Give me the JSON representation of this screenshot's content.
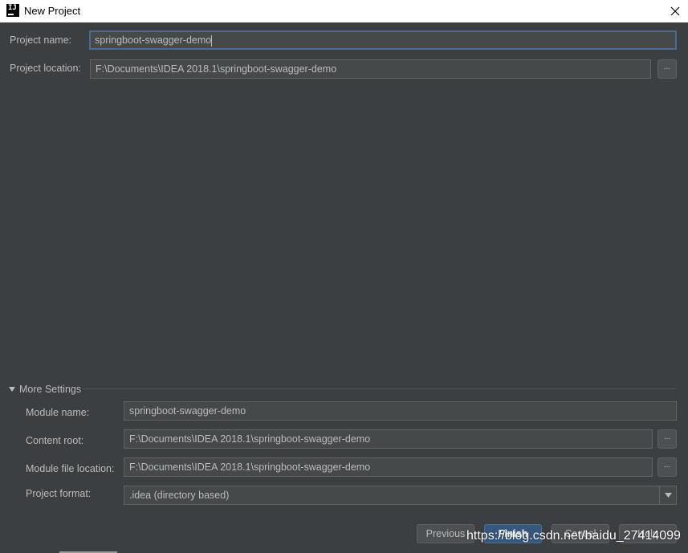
{
  "window": {
    "title": "New Project",
    "logo_text": "IJ"
  },
  "project": {
    "name_label": "Project name:",
    "name_value": "springboot-swagger-demo",
    "location_label": "Project location:",
    "location_value": "F:\\Documents\\IDEA 2018.1\\springboot-swagger-demo"
  },
  "more_settings": {
    "header": "More Settings",
    "module_name_label": "Module name:",
    "module_name_value": "springboot-swagger-demo",
    "content_root_label": "Content root:",
    "content_root_value": "F:\\Documents\\IDEA 2018.1\\springboot-swagger-demo",
    "module_file_label": "Module file location:",
    "module_file_value": "F:\\Documents\\IDEA 2018.1\\springboot-swagger-demo",
    "format_label": "Project format:",
    "format_value": ".idea (directory based)"
  },
  "browse_label": "...",
  "buttons": {
    "previous": "Previous",
    "finish": "Finish",
    "cancel": "Cancel",
    "help": "Help"
  },
  "watermark": "https://blog.csdn.net/baidu_27414099",
  "colors": {
    "background": "#3c3f41",
    "field": "#45494a",
    "focus_border": "#466d94",
    "primary_button": "#365880"
  }
}
